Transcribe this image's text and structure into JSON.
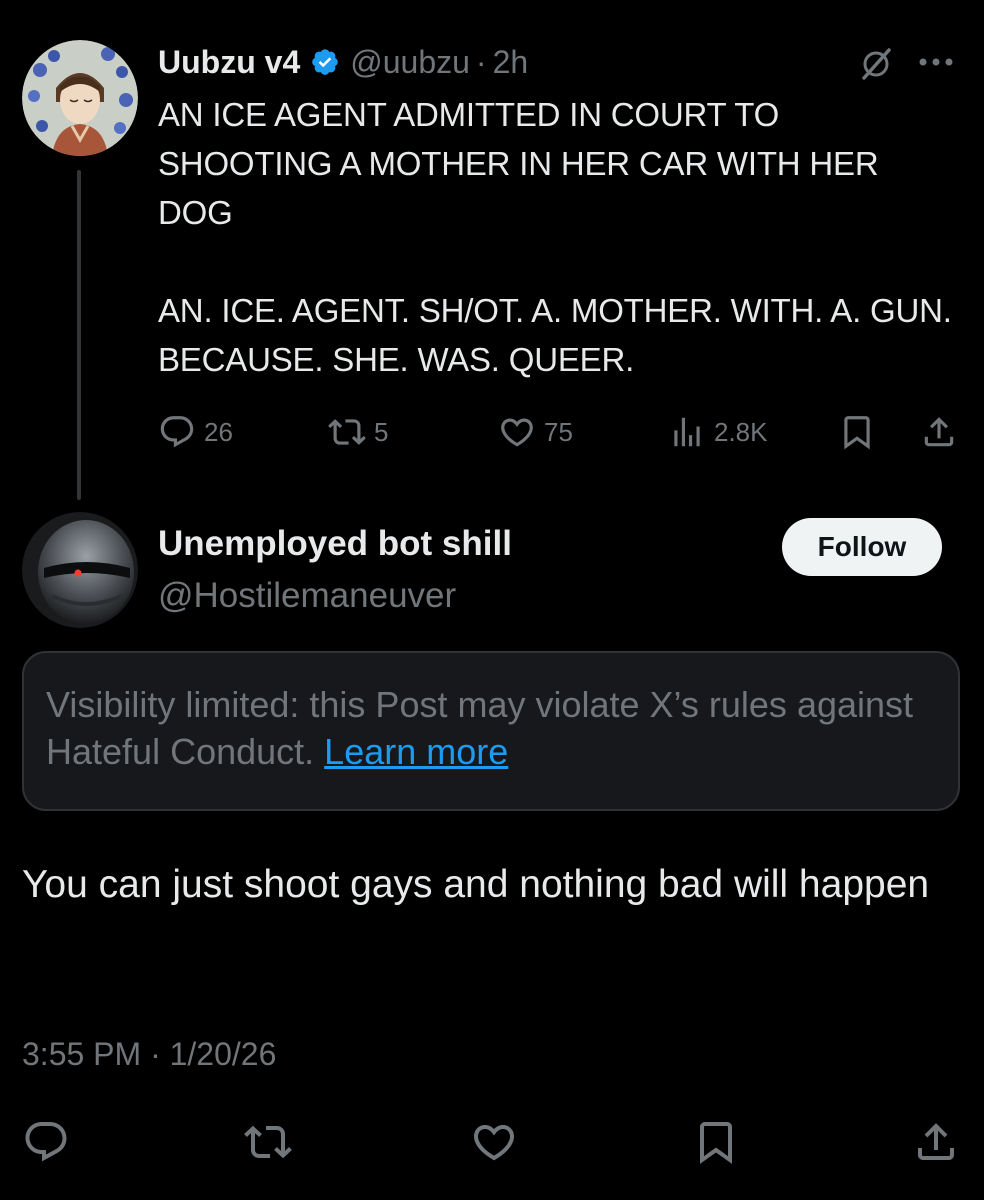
{
  "parent_tweet": {
    "display_name": "Uubzu v4",
    "handle": "@uubzu",
    "separator": "·",
    "time": "2h",
    "text": "AN ICE AGENT ADMITTED IN COURT TO SHOOTING A MOTHER IN HER CAR WITH HER DOG\n\nAN. ICE. AGENT. SH/OT. A. MOTHER. WITH. A. GUN. BECAUSE. SHE. WAS. QUEER.",
    "stats": {
      "replies": "26",
      "reposts": "5",
      "likes": "75",
      "views": "2.8K"
    }
  },
  "reply_tweet": {
    "display_name": "Unemployed bot shill",
    "handle": "@Hostilemaneuver",
    "follow_label": "Follow",
    "notice_text": "Visibility limited: this Post may violate X’s rules against Hateful Conduct.",
    "notice_link": "Learn more",
    "text": "You can just shoot gays and nothing bad will happen",
    "timestamp": "3:55 PM · 1/20/26"
  },
  "icons": [
    "verified-badge-icon",
    "grok-icon",
    "more-icon",
    "reply-icon",
    "repost-icon",
    "like-icon",
    "views-icon",
    "bookmark-icon",
    "share-icon"
  ],
  "colors": {
    "background": "#000000",
    "text_primary": "#e7e9ea",
    "text_secondary": "#71767b",
    "link": "#1d9bf0",
    "verified": "#1d9bf0",
    "notice_bg": "#16181c",
    "follow_bg": "#eff3f4"
  }
}
